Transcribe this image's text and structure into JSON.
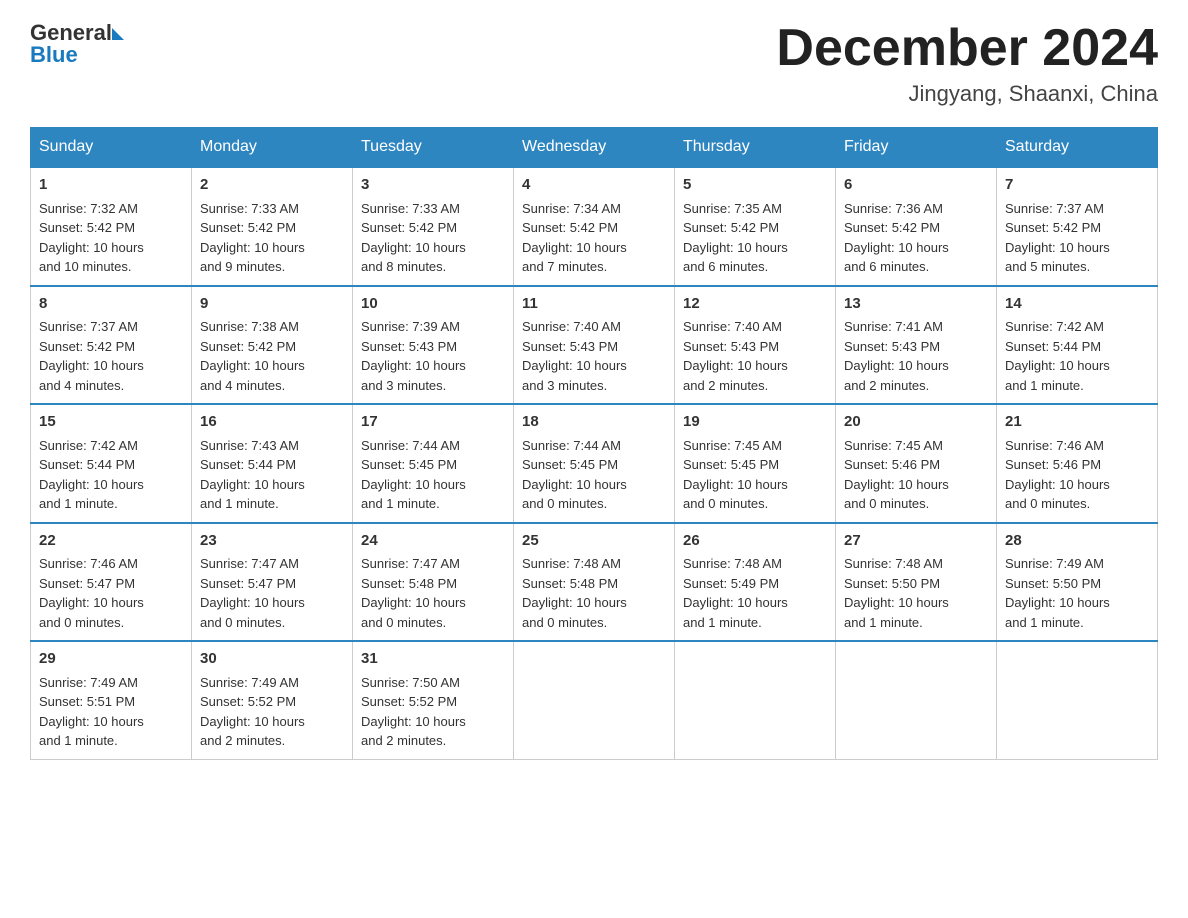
{
  "header": {
    "logo_general": "General",
    "logo_blue": "Blue",
    "month_title": "December 2024",
    "location": "Jingyang, Shaanxi, China"
  },
  "days_of_week": [
    "Sunday",
    "Monday",
    "Tuesday",
    "Wednesday",
    "Thursday",
    "Friday",
    "Saturday"
  ],
  "weeks": [
    [
      {
        "day": "1",
        "sunrise": "7:32 AM",
        "sunset": "5:42 PM",
        "daylight": "10 hours and 10 minutes."
      },
      {
        "day": "2",
        "sunrise": "7:33 AM",
        "sunset": "5:42 PM",
        "daylight": "10 hours and 9 minutes."
      },
      {
        "day": "3",
        "sunrise": "7:33 AM",
        "sunset": "5:42 PM",
        "daylight": "10 hours and 8 minutes."
      },
      {
        "day": "4",
        "sunrise": "7:34 AM",
        "sunset": "5:42 PM",
        "daylight": "10 hours and 7 minutes."
      },
      {
        "day": "5",
        "sunrise": "7:35 AM",
        "sunset": "5:42 PM",
        "daylight": "10 hours and 6 minutes."
      },
      {
        "day": "6",
        "sunrise": "7:36 AM",
        "sunset": "5:42 PM",
        "daylight": "10 hours and 6 minutes."
      },
      {
        "day": "7",
        "sunrise": "7:37 AM",
        "sunset": "5:42 PM",
        "daylight": "10 hours and 5 minutes."
      }
    ],
    [
      {
        "day": "8",
        "sunrise": "7:37 AM",
        "sunset": "5:42 PM",
        "daylight": "10 hours and 4 minutes."
      },
      {
        "day": "9",
        "sunrise": "7:38 AM",
        "sunset": "5:42 PM",
        "daylight": "10 hours and 4 minutes."
      },
      {
        "day": "10",
        "sunrise": "7:39 AM",
        "sunset": "5:43 PM",
        "daylight": "10 hours and 3 minutes."
      },
      {
        "day": "11",
        "sunrise": "7:40 AM",
        "sunset": "5:43 PM",
        "daylight": "10 hours and 3 minutes."
      },
      {
        "day": "12",
        "sunrise": "7:40 AM",
        "sunset": "5:43 PM",
        "daylight": "10 hours and 2 minutes."
      },
      {
        "day": "13",
        "sunrise": "7:41 AM",
        "sunset": "5:43 PM",
        "daylight": "10 hours and 2 minutes."
      },
      {
        "day": "14",
        "sunrise": "7:42 AM",
        "sunset": "5:44 PM",
        "daylight": "10 hours and 1 minute."
      }
    ],
    [
      {
        "day": "15",
        "sunrise": "7:42 AM",
        "sunset": "5:44 PM",
        "daylight": "10 hours and 1 minute."
      },
      {
        "day": "16",
        "sunrise": "7:43 AM",
        "sunset": "5:44 PM",
        "daylight": "10 hours and 1 minute."
      },
      {
        "day": "17",
        "sunrise": "7:44 AM",
        "sunset": "5:45 PM",
        "daylight": "10 hours and 1 minute."
      },
      {
        "day": "18",
        "sunrise": "7:44 AM",
        "sunset": "5:45 PM",
        "daylight": "10 hours and 0 minutes."
      },
      {
        "day": "19",
        "sunrise": "7:45 AM",
        "sunset": "5:45 PM",
        "daylight": "10 hours and 0 minutes."
      },
      {
        "day": "20",
        "sunrise": "7:45 AM",
        "sunset": "5:46 PM",
        "daylight": "10 hours and 0 minutes."
      },
      {
        "day": "21",
        "sunrise": "7:46 AM",
        "sunset": "5:46 PM",
        "daylight": "10 hours and 0 minutes."
      }
    ],
    [
      {
        "day": "22",
        "sunrise": "7:46 AM",
        "sunset": "5:47 PM",
        "daylight": "10 hours and 0 minutes."
      },
      {
        "day": "23",
        "sunrise": "7:47 AM",
        "sunset": "5:47 PM",
        "daylight": "10 hours and 0 minutes."
      },
      {
        "day": "24",
        "sunrise": "7:47 AM",
        "sunset": "5:48 PM",
        "daylight": "10 hours and 0 minutes."
      },
      {
        "day": "25",
        "sunrise": "7:48 AM",
        "sunset": "5:48 PM",
        "daylight": "10 hours and 0 minutes."
      },
      {
        "day": "26",
        "sunrise": "7:48 AM",
        "sunset": "5:49 PM",
        "daylight": "10 hours and 1 minute."
      },
      {
        "day": "27",
        "sunrise": "7:48 AM",
        "sunset": "5:50 PM",
        "daylight": "10 hours and 1 minute."
      },
      {
        "day": "28",
        "sunrise": "7:49 AM",
        "sunset": "5:50 PM",
        "daylight": "10 hours and 1 minute."
      }
    ],
    [
      {
        "day": "29",
        "sunrise": "7:49 AM",
        "sunset": "5:51 PM",
        "daylight": "10 hours and 1 minute."
      },
      {
        "day": "30",
        "sunrise": "7:49 AM",
        "sunset": "5:52 PM",
        "daylight": "10 hours and 2 minutes."
      },
      {
        "day": "31",
        "sunrise": "7:50 AM",
        "sunset": "5:52 PM",
        "daylight": "10 hours and 2 minutes."
      },
      null,
      null,
      null,
      null
    ]
  ],
  "labels": {
    "sunrise": "Sunrise:",
    "sunset": "Sunset:",
    "daylight": "Daylight:"
  }
}
